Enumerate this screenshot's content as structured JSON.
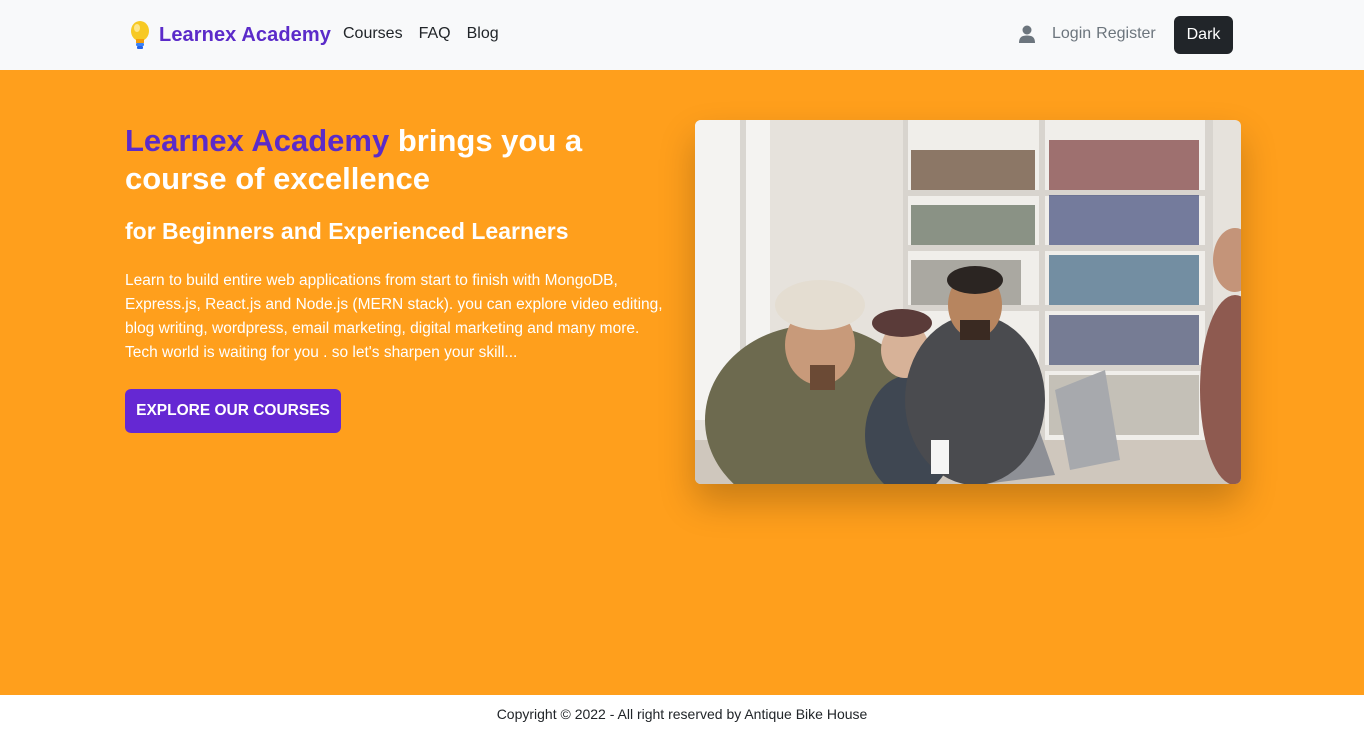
{
  "navbar": {
    "brand": "Learnex Academy",
    "links": [
      "Courses",
      "FAQ",
      "Blog"
    ],
    "login": "Login",
    "register": "Register",
    "theme_button": "Dark"
  },
  "hero": {
    "title_accent": "Learnex Academy",
    "title_rest": " brings you a course of excellence",
    "subtitle": "for Beginners and Experienced Learners",
    "description": "Learn to build entire web applications from start to finish with MongoDB, Express.js, React.js and Node.js (MERN stack). you can explore video editing, blog writing, wordpress, email marketing, digital marketing and many more. Tech world is waiting for you . so let's sharpen your skill...",
    "cta_label": "EXPLORE OUR COURSES"
  },
  "footer": {
    "copyright": "Copyright © 2022 - All right reserved by Antique Bike House"
  },
  "colors": {
    "brand_purple": "#5b2bc9",
    "hero_background": "#ff9f1c",
    "navbar_background": "#f8f9fa",
    "dark_button": "#212529",
    "cta_button": "#6528d3"
  },
  "icons": {
    "brand": "lightbulb-icon",
    "user": "user-icon"
  }
}
